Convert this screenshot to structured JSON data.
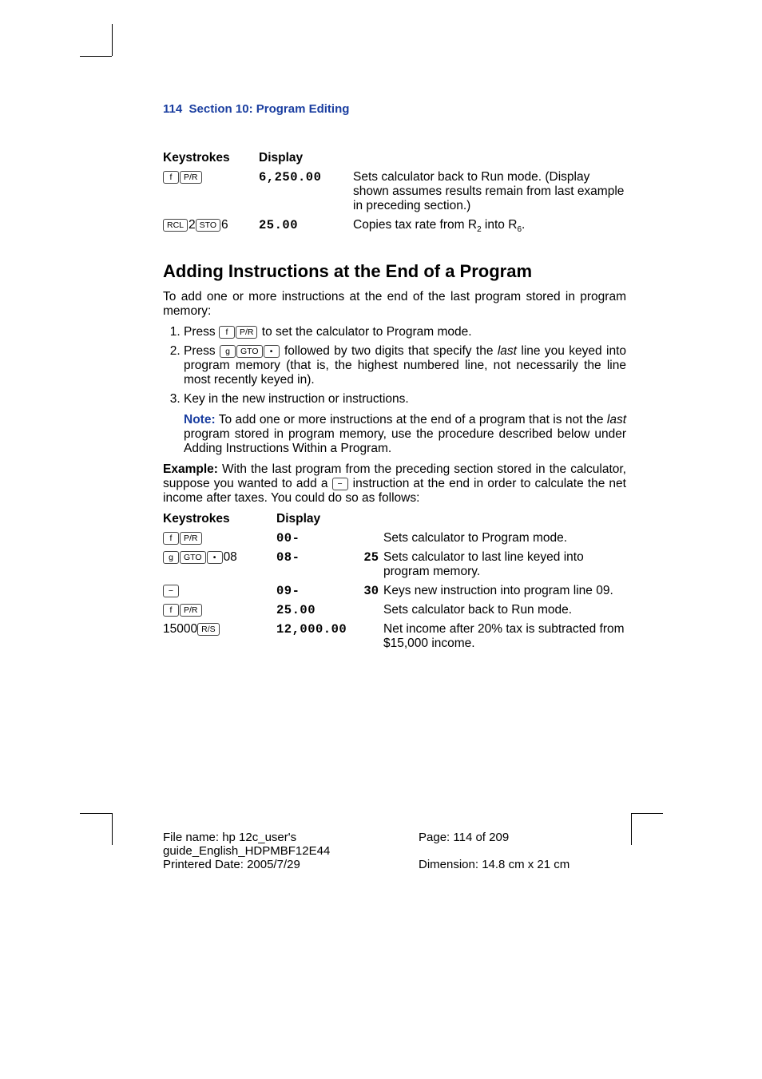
{
  "header": {
    "page_num": "114",
    "section_title": "Section 10: Program Editing"
  },
  "table1": {
    "headers": {
      "k": "Keystrokes",
      "d": "Display"
    },
    "rows": [
      {
        "keys": [
          "f",
          "P/R"
        ],
        "display": "6,250.00",
        "desc": "Sets calculator back to Run mode. (Display shown assumes results remain from last example in preceding section.)"
      },
      {
        "keys_html": "RCL-2-STO-6",
        "keys": [
          "RCL"
        ],
        "keys_text1": "2",
        "keys2": [
          "STO"
        ],
        "keys_text2": "6",
        "display": "25.00",
        "desc_pre": "Copies tax rate from R",
        "desc_sub1": "2",
        "desc_mid": " into R",
        "desc_sub2": "6",
        "desc_post": "."
      }
    ]
  },
  "heading2": "Adding Instructions at the End of a Program",
  "para1": "To add one or more instructions at the end of the last program stored in program memory:",
  "steps": [
    {
      "pre": "Press ",
      "keys": [
        "f",
        "P/R"
      ],
      "post": " to set the calculator to Program mode."
    },
    {
      "pre": "Press ",
      "keys": [
        "g",
        "GTO",
        "•"
      ],
      "post_a": " followed by two digits that specify the ",
      "post_it": "last",
      "post_b": " line you keyed into program memory (that is, the highest numbered line, not necessarily the line most recently keyed in)."
    },
    {
      "plain": "Key in the new instruction or instructions."
    }
  ],
  "note": {
    "label": "Note:",
    "body_a": " To add one or more instructions at the end of a program that is not the ",
    "body_it": "last",
    "body_b": " program stored in program memory, use the procedure described below under Adding Instructions Within a Program."
  },
  "example": {
    "label": "Example:",
    "body_a": " With the last program from the preceding section stored in the calculator, suppose you wanted to add a ",
    "key": "−",
    "body_b": " instruction at the end in order to calculate the net income after taxes. You could do so as follows:"
  },
  "table2": {
    "headers": {
      "k": "Keystrokes",
      "d": "Display"
    },
    "rows": [
      {
        "keys": [
          "f",
          "P/R"
        ],
        "display": "00-",
        "code": "",
        "desc": "Sets calculator to Program mode."
      },
      {
        "keys": [
          "g",
          "GTO",
          "•"
        ],
        "suffix": "08",
        "display": "08-",
        "code": "25",
        "desc": "Sets calculator to last line keyed into program memory."
      },
      {
        "keys": [
          "−"
        ],
        "display": "09-",
        "code": "30",
        "desc": "Keys new instruction into program line 09."
      },
      {
        "keys": [
          "f",
          "P/R"
        ],
        "display": "25.00",
        "code": "",
        "desc": "Sets calculator back to Run mode."
      },
      {
        "prefix": "15000",
        "keys": [
          "R/S"
        ],
        "display": "12,000.00",
        "code": "",
        "desc": "Net income after 20% tax is subtracted from $15,000 income."
      }
    ]
  },
  "footer": {
    "filename_label": "File name: ",
    "filename": "hp 12c_user's guide_English_HDPMBF12E44",
    "page_label": "Page: ",
    "page": "114 of 209",
    "printed_label": "Printered Date: ",
    "printed": "2005/7/29",
    "dim_label": "Dimension: ",
    "dim": "14.8 cm x 21 cm"
  }
}
